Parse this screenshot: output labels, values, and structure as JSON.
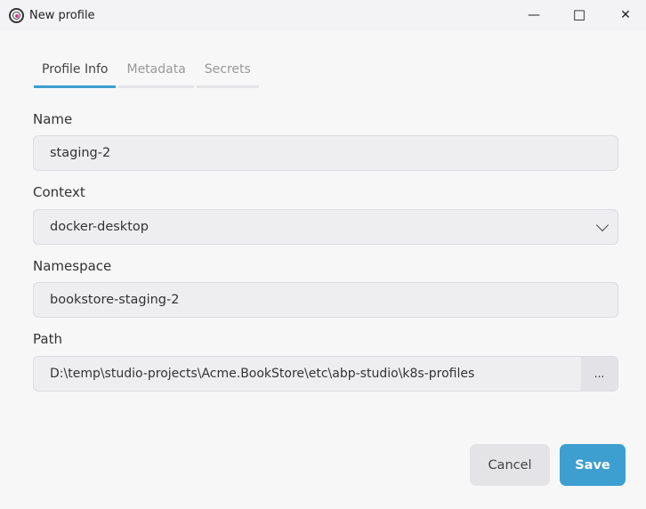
{
  "window": {
    "title": "New profile",
    "minimize": "—",
    "maximize": "☐",
    "close": "✕"
  },
  "tabs": [
    {
      "label": "Profile Info",
      "active": true
    },
    {
      "label": "Metadata"
    },
    {
      "label": "Secrets"
    }
  ],
  "form": {
    "name": {
      "label": "Name",
      "value": "staging-2"
    },
    "context": {
      "label": "Context",
      "value": "docker-desktop"
    },
    "namespace": {
      "label": "Namespace",
      "value": "bookstore-staging-2"
    },
    "path": {
      "label": "Path",
      "value": "D:\\temp\\studio-projects\\Acme.BookStore\\etc\\abp-studio\\k8s-profiles",
      "browse_label": "..."
    }
  },
  "actions": {
    "cancel": "Cancel",
    "save": "Save"
  },
  "colors": {
    "accent": "#3d9fcf"
  }
}
